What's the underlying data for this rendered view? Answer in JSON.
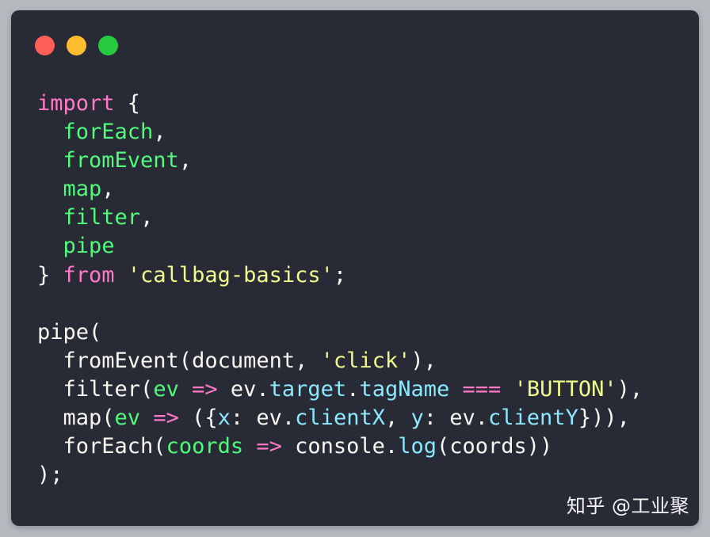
{
  "colors": {
    "keyword": "#ff79c6",
    "function": "#50fa7b",
    "string": "#f1fa8c",
    "property": "#8be9fd",
    "text": "#f8f8f2",
    "window_bg": "#282a36",
    "close": "#ff5f56",
    "minimize": "#ffbd2e",
    "zoom": "#27c93f"
  },
  "window_controls": [
    {
      "name": "close-button",
      "color": "#ff5f56"
    },
    {
      "name": "minimize-button",
      "color": "#ffbd2e"
    },
    {
      "name": "zoom-button",
      "color": "#27c93f"
    }
  ],
  "code_lines": [
    [
      {
        "t": "import",
        "c": "keyword"
      },
      {
        "t": " {",
        "c": "text"
      }
    ],
    [
      {
        "t": "  ",
        "c": "text"
      },
      {
        "t": "forEach",
        "c": "function"
      },
      {
        "t": ",",
        "c": "text"
      }
    ],
    [
      {
        "t": "  ",
        "c": "text"
      },
      {
        "t": "fromEvent",
        "c": "function"
      },
      {
        "t": ",",
        "c": "text"
      }
    ],
    [
      {
        "t": "  ",
        "c": "text"
      },
      {
        "t": "map",
        "c": "function"
      },
      {
        "t": ",",
        "c": "text"
      }
    ],
    [
      {
        "t": "  ",
        "c": "text"
      },
      {
        "t": "filter",
        "c": "function"
      },
      {
        "t": ",",
        "c": "text"
      }
    ],
    [
      {
        "t": "  ",
        "c": "text"
      },
      {
        "t": "pipe",
        "c": "function"
      }
    ],
    [
      {
        "t": "} ",
        "c": "text"
      },
      {
        "t": "from",
        "c": "keyword"
      },
      {
        "t": " ",
        "c": "text"
      },
      {
        "t": "'callbag-basics'",
        "c": "string"
      },
      {
        "t": ";",
        "c": "text"
      }
    ],
    [],
    [
      {
        "t": "pipe(",
        "c": "text"
      }
    ],
    [
      {
        "t": "  fromEvent(document, ",
        "c": "text"
      },
      {
        "t": "'click'",
        "c": "string"
      },
      {
        "t": "),",
        "c": "text"
      }
    ],
    [
      {
        "t": "  filter(",
        "c": "text"
      },
      {
        "t": "ev",
        "c": "function"
      },
      {
        "t": " ",
        "c": "text"
      },
      {
        "t": "=>",
        "c": "keyword"
      },
      {
        "t": " ev.",
        "c": "text"
      },
      {
        "t": "target",
        "c": "property"
      },
      {
        "t": ".",
        "c": "text"
      },
      {
        "t": "tagName",
        "c": "property"
      },
      {
        "t": " ",
        "c": "text"
      },
      {
        "t": "===",
        "c": "keyword"
      },
      {
        "t": " ",
        "c": "text"
      },
      {
        "t": "'BUTTON'",
        "c": "string"
      },
      {
        "t": "),",
        "c": "text"
      }
    ],
    [
      {
        "t": "  map(",
        "c": "text"
      },
      {
        "t": "ev",
        "c": "function"
      },
      {
        "t": " ",
        "c": "text"
      },
      {
        "t": "=>",
        "c": "keyword"
      },
      {
        "t": " ({",
        "c": "text"
      },
      {
        "t": "x",
        "c": "property"
      },
      {
        "t": ": ev.",
        "c": "text"
      },
      {
        "t": "clientX",
        "c": "property"
      },
      {
        "t": ", ",
        "c": "text"
      },
      {
        "t": "y",
        "c": "property"
      },
      {
        "t": ": ev.",
        "c": "text"
      },
      {
        "t": "clientY",
        "c": "property"
      },
      {
        "t": "})),",
        "c": "text"
      }
    ],
    [
      {
        "t": "  forEach(",
        "c": "text"
      },
      {
        "t": "coords",
        "c": "function"
      },
      {
        "t": " ",
        "c": "text"
      },
      {
        "t": "=>",
        "c": "keyword"
      },
      {
        "t": " console.",
        "c": "text"
      },
      {
        "t": "log",
        "c": "property"
      },
      {
        "t": "(coords))",
        "c": "text"
      }
    ],
    [
      {
        "t": ");",
        "c": "text"
      }
    ]
  ],
  "watermark": "知乎 @工业聚"
}
